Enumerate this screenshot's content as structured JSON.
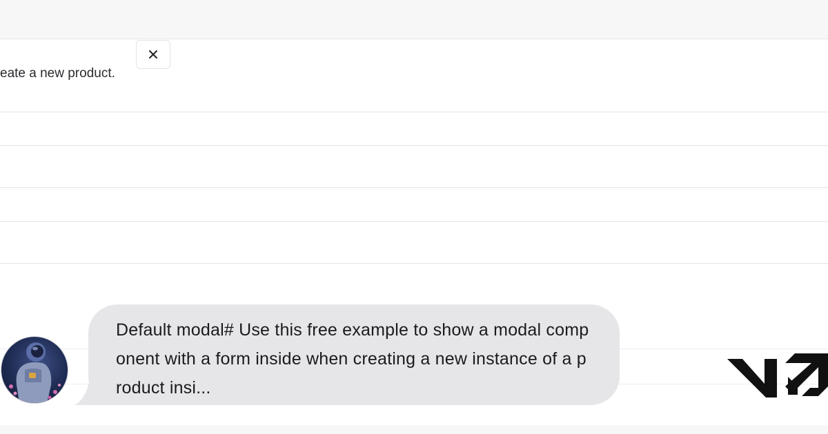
{
  "modal": {
    "subtitle": "eate a new product.",
    "close_icon": "close-icon"
  },
  "chat": {
    "message": "Default modal# Use this free example to show a modal component with a form inside when creating a new instance of a product insi...",
    "avatar_icon": "astronaut-avatar"
  },
  "brand": {
    "logo": "v0-logo"
  }
}
